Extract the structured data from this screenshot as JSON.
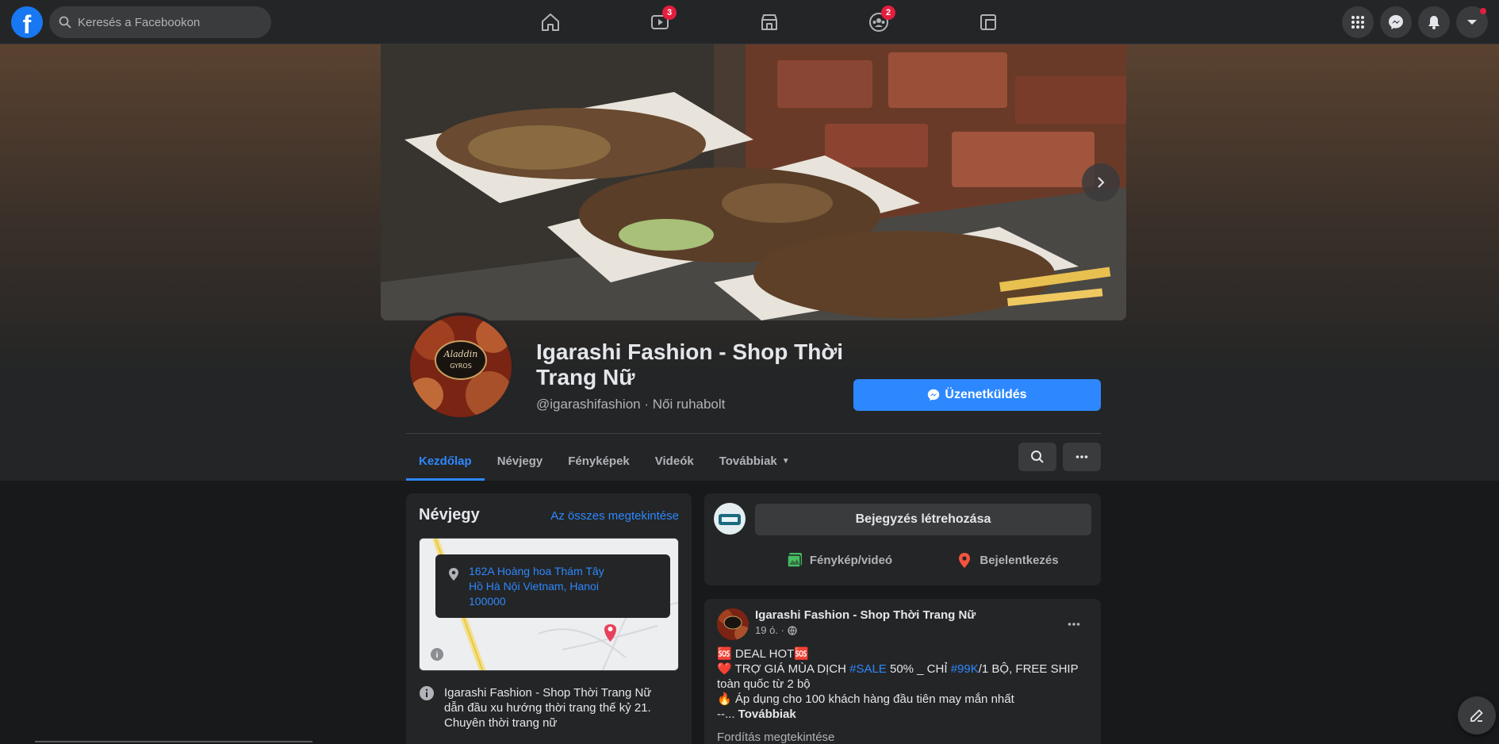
{
  "search": {
    "placeholder": "Keresés a Facebookon"
  },
  "nav": {
    "video_badge": "3",
    "groups_badge": "2"
  },
  "page": {
    "name": "Igarashi Fashion - Shop Thời Trang Nữ",
    "handle": "@igarashifashion · Női ruhabolt",
    "message_button": "Üzenetküldés",
    "profile_logo_text": "Aladdin GYROS"
  },
  "tabs": [
    {
      "label": "Kezdőlap",
      "active": true
    },
    {
      "label": "Névjegy"
    },
    {
      "label": "Fényképek"
    },
    {
      "label": "Videók"
    },
    {
      "label": "Továbbiak"
    }
  ],
  "about": {
    "title": "Névjegy",
    "see_all": "Az összes megtekintése",
    "address": [
      "162A Hoàng hoa Thám Tây",
      "Hồ Hà Nội Vietnam, Hanoi",
      "100000"
    ],
    "description": "Igarashi Fashion - Shop Thời Trang Nữ dẫn đầu xu hướng thời trang thế kỷ 21. Chuyên thời trang nữ"
  },
  "create_post": {
    "button": "Bejegyzés létrehozása",
    "photo_video": "Fénykép/videó",
    "checkin": "Bejelentkezés"
  },
  "post": {
    "author": "Igarashi Fashion - Shop Thời Trang Nữ",
    "time": "19 ó. ·",
    "line1": "🆘 DEAL HOT🆘",
    "line2_pre": "❤️ TRỢ GIÁ MÙA DỊCH ",
    "line2_tag1": "#SALE",
    "line2_mid": " 50% _ CHỈ ",
    "line2_tag2": "#99K",
    "line2_post": "/1 BỘ, FREE SHIP toàn quốc từ 2 bộ",
    "line3": "🔥 Áp dụng cho 100 khách hàng đầu tiên may mắn nhất",
    "line4_pre": "--... ",
    "line4_more": "Továbbiak",
    "translate": "Fordítás megtekintése"
  },
  "colors": {
    "accent": "#2d88ff",
    "brand": "#1877f2",
    "badge": "#e41e3f"
  }
}
